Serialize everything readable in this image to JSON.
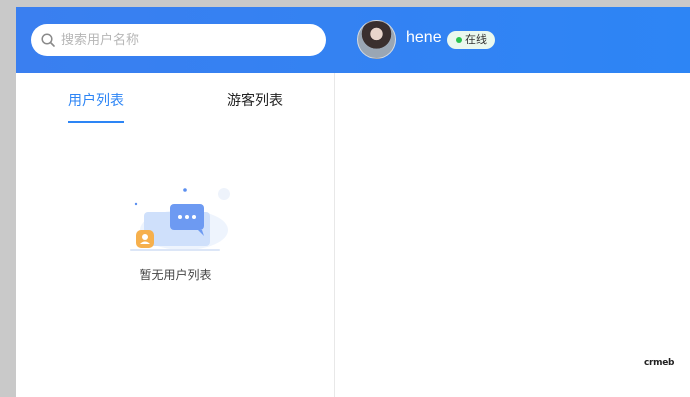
{
  "search": {
    "placeholder": "搜索用户名称"
  },
  "user": {
    "name": "hene",
    "status": "在线"
  },
  "tabs": [
    {
      "label": "用户列表",
      "active": true
    },
    {
      "label": "游客列表",
      "active": false
    }
  ],
  "empty_state": {
    "text": "暂无用户列表"
  },
  "brand": {
    "logo_text": "crmeb"
  },
  "colors": {
    "header_blue": "#2d85f5",
    "status_green": "#2ac34f",
    "active_tab": "#2d85f5"
  }
}
